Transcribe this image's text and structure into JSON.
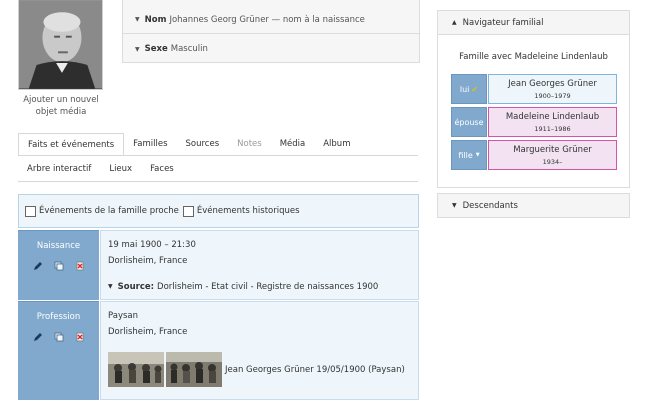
{
  "photo": {
    "add_media_label": "Ajouter un nouvel objet média"
  },
  "info": {
    "name_label": "Nom",
    "name_value": "Johannes Georg Grüner — nom à la naissance",
    "sex_label": "Sexe",
    "sex_value": "Masculin"
  },
  "tabs": {
    "row1": [
      "Faits et événements",
      "Familles",
      "Sources",
      "Notes",
      "Média",
      "Album"
    ],
    "row2": [
      "Arbre interactif",
      "Lieux",
      "Faces"
    ],
    "active": "Faits et événements"
  },
  "filters": {
    "close_family": "Événements de la famille proche",
    "historical": "Événements historiques"
  },
  "facts": [
    {
      "label": "Naissance",
      "date": "19 mai 1900 – 21:30",
      "place": "Dorlisheim, France",
      "source_label": "Source:",
      "source_value": "Dorlisheim - Etat civil - Registre de naissances 1900"
    },
    {
      "label": "Profession",
      "value": "Paysan",
      "place": "Dorlisheim, France",
      "media_caption": "Jean Georges Grüner 19/05/1900 (Paysan)"
    }
  ],
  "family_nav": {
    "title": "Navigateur familial",
    "family_label": "Famille avec Madeleine Lindenlaub",
    "rows": [
      {
        "rel": "lui",
        "name": "Jean Georges Grüner",
        "dates": "1900–1979",
        "sex": "male"
      },
      {
        "rel": "épouse",
        "name": "Madeleine Lindenlaub",
        "dates": "1911–1986",
        "sex": "female"
      },
      {
        "rel": "fille",
        "name": "Marguerite Grüner",
        "dates": "1934–",
        "sex": "female"
      }
    ]
  },
  "descendants": {
    "title": "Descendants"
  },
  "colors": {
    "label_blue": "#81a9cd",
    "light_blue": "#eef6fb",
    "male_border": "#7fb4dc",
    "female_border": "#d454a8",
    "female_bg": "#f3e3f2"
  }
}
